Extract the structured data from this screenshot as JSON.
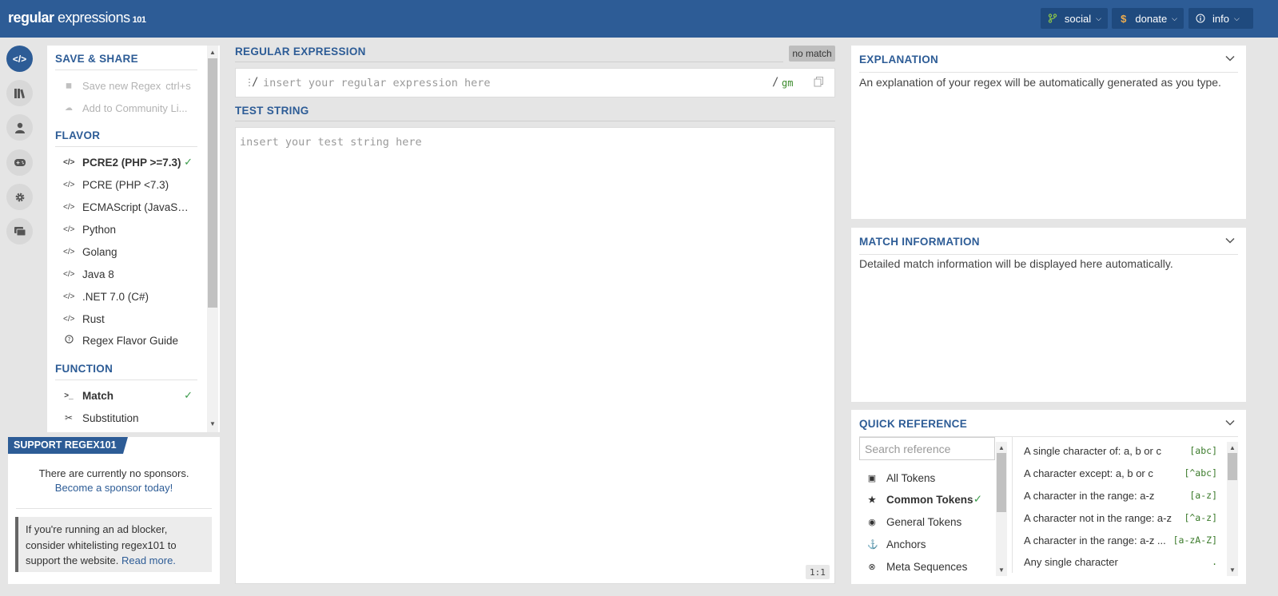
{
  "header": {
    "logo_bold": "regular",
    "logo_rest": " expressions",
    "logo_version": "101",
    "buttons": [
      {
        "label": "social",
        "icon": "git-branch-icon"
      },
      {
        "label": "donate",
        "icon": "dollar-icon"
      },
      {
        "label": "info",
        "icon": "info-icon"
      }
    ]
  },
  "rail": {
    "items": [
      "regex-editor-icon",
      "library-icon",
      "account-icon",
      "quiz-icon",
      "settings-icon",
      "chat-icon"
    ]
  },
  "left": {
    "save_share": {
      "title": "SAVE & SHARE",
      "save_label": "Save new Regex",
      "save_shortcut": "ctrl+s",
      "community_label": "Add to Community Li..."
    },
    "flavor": {
      "title": "FLAVOR",
      "items": [
        {
          "label": "PCRE2 (PHP >=7.3)",
          "selected": true
        },
        {
          "label": "PCRE (PHP <7.3)"
        },
        {
          "label": "ECMAScript (JavaScript)"
        },
        {
          "label": "Python"
        },
        {
          "label": "Golang"
        },
        {
          "label": "Java 8"
        },
        {
          "label": ".NET 7.0 (C#)"
        },
        {
          "label": "Rust"
        },
        {
          "label": "Regex Flavor Guide"
        }
      ]
    },
    "function": {
      "title": "FUNCTION",
      "items": [
        {
          "label": "Match",
          "selected": true
        },
        {
          "label": "Substitution"
        }
      ]
    }
  },
  "support": {
    "tag": "SUPPORT REGEX101",
    "no_sponsors": "There are currently no sponsors.",
    "become": "Become a sponsor today!",
    "adblock_text": "If you're running an ad blocker, consider whitelisting regex101 to support the website.",
    "read_more": "Read more."
  },
  "main": {
    "regex_title": "REGULAR EXPRESSION",
    "no_match": "no match",
    "regex_delim_open": "/",
    "regex_placeholder": "insert your regular expression here",
    "regex_delim_close": "/",
    "flags": "gm",
    "test_title": "TEST STRING",
    "test_placeholder": "insert your test string here",
    "cursor_pos": "1:1"
  },
  "explanation": {
    "title": "EXPLANATION",
    "text": "An explanation of your regex will be automatically generated as you type."
  },
  "match_info": {
    "title": "MATCH INFORMATION",
    "text": "Detailed match information will be displayed here automatically."
  },
  "quick_ref": {
    "title": "QUICK REFERENCE",
    "search_placeholder": "Search reference",
    "categories": [
      {
        "label": "All Tokens"
      },
      {
        "label": "Common Tokens",
        "selected": true
      },
      {
        "label": "General Tokens"
      },
      {
        "label": "Anchors"
      },
      {
        "label": "Meta Sequences"
      }
    ],
    "rows": [
      {
        "desc": "A single character of: a, b or c",
        "code": "[abc]"
      },
      {
        "desc": "A character except: a, b or c",
        "code": "[^abc]"
      },
      {
        "desc": "A character in the range: a-z",
        "code": "[a-z]"
      },
      {
        "desc": "A character not in the range: a-z",
        "code": "[^a-z]"
      },
      {
        "desc": "A character in the range: a-z ...",
        "code": "[a-zA-Z]"
      },
      {
        "desc": "Any single character",
        "code": "."
      }
    ]
  },
  "colors": {
    "brand": "#2d5c96",
    "check": "#3a9a4a",
    "flags": "#3a8a2a"
  }
}
